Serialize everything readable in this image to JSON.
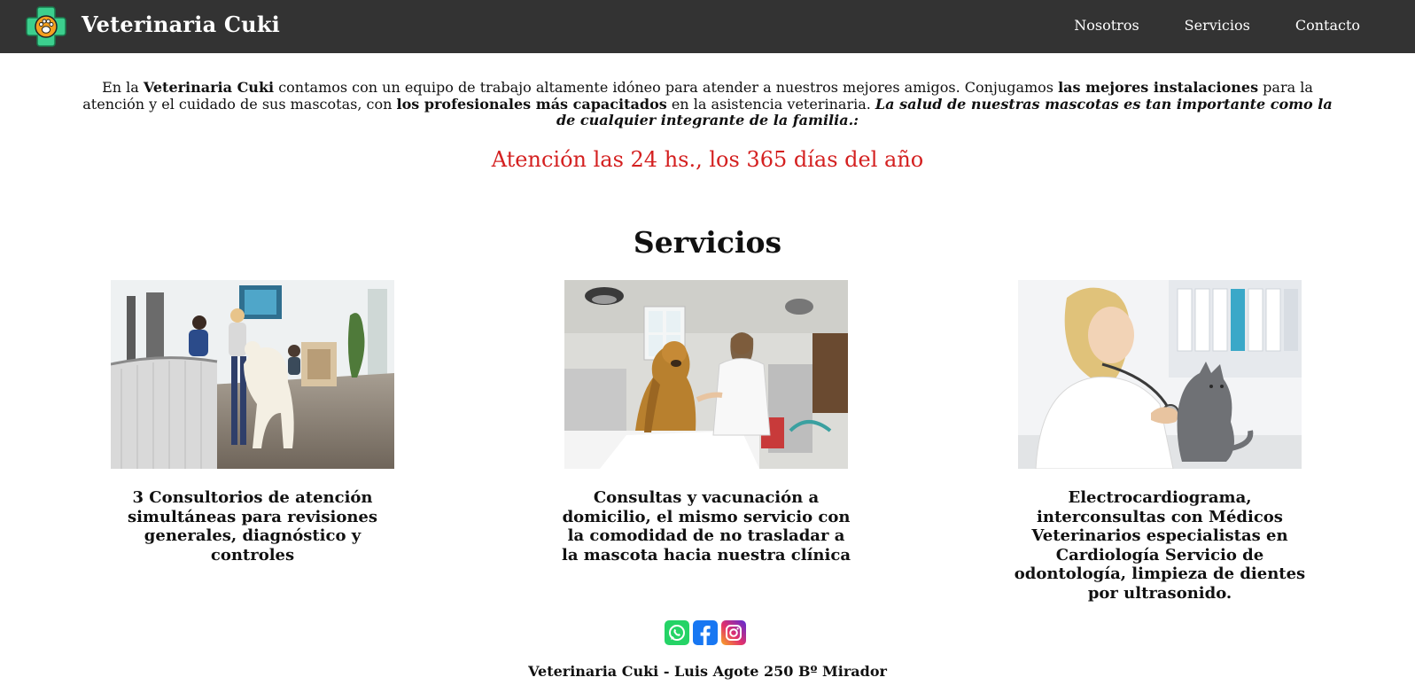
{
  "header": {
    "brand": "Veterinaria Cuki",
    "nav": [
      "Nosotros",
      "Servicios",
      "Contacto"
    ]
  },
  "intro": {
    "p1": "En la ",
    "b1": "Veterinaria Cuki",
    "p2": " contamos con un equipo de trabajo altamente idóneo para atender a nuestros mejores amigos. Conjugamos ",
    "b2": "las mejores instalaciones",
    "p3": " para la atención y el cuidado de sus mascotas, con ",
    "b3": "los profesionales más capacitados",
    "p4": " en la asistencia veterinaria. ",
    "quote": "La salud de nuestras mascotas es tan importante como la de cualquier integrante de la familia.:"
  },
  "hours": "Atención las 24 hs., los 365 días del año",
  "services": {
    "title": "Servicios",
    "items": [
      {
        "caption": "3 Consultorios de atención simultáneas para revisiones generales, diagnóstico y controles",
        "image": "veterinary-reception-photo"
      },
      {
        "caption": "Consultas y vacunación a domicilio, el mismo servicio con la comodidad de no trasladar a la mascota hacia nuestra clínica",
        "image": "golden-retriever-with-vet-photo"
      },
      {
        "caption": "Electrocardiograma, interconsultas con Médicos Veterinarios especialistas en Cardiología Servicio de odontología, limpieza de dientes por ultrasonido.",
        "image": "vet-examining-kitten-photo"
      }
    ]
  },
  "social": [
    "whatsapp-icon",
    "facebook-icon",
    "instagram-icon"
  ],
  "colors": {
    "navbar": "#333333",
    "accent_red": "#d42020",
    "logo_green": "#3ccf8e",
    "logo_orange": "#f5a020",
    "whatsapp": "#25d366",
    "facebook": "#1877f2"
  },
  "footer": "Veterinaria Cuki - Luis Agote 250 Bº Mirador"
}
